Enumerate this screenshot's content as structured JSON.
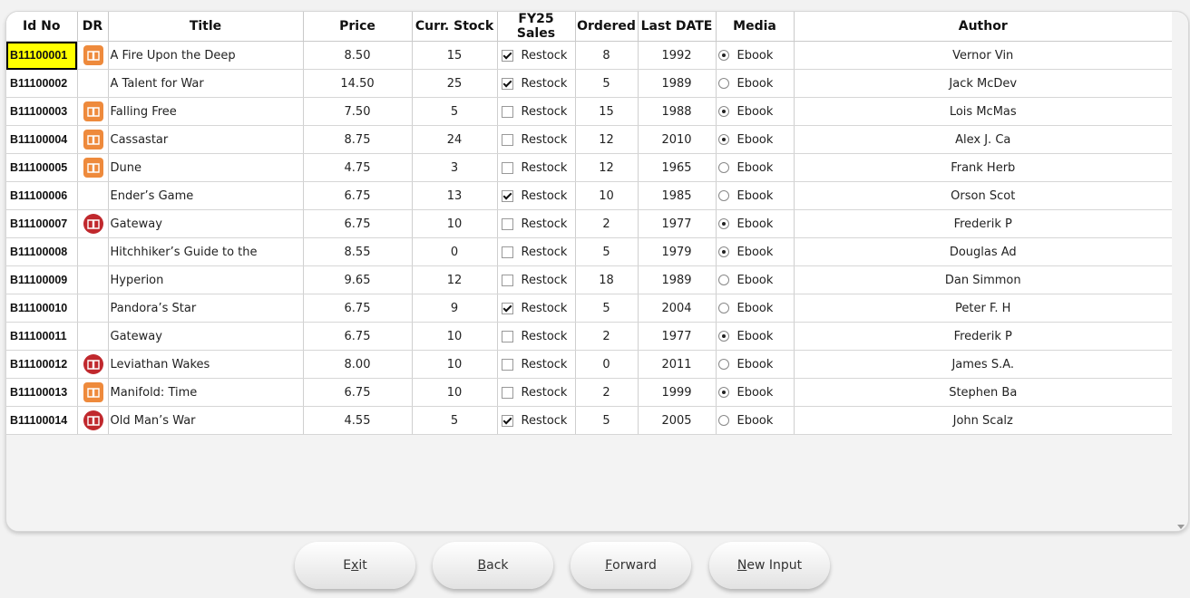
{
  "columns": [
    "Id No",
    "DR",
    "Title",
    "Price",
    "Curr. Stock",
    "FY25 Sales",
    "Ordered",
    "Last DATE",
    "Media",
    "Author"
  ],
  "rows": [
    {
      "id": "B11100001",
      "dr": "square",
      "title": "A Fire Upon the Deep",
      "price": "8.50",
      "stock": "15",
      "sales_checked": true,
      "sales_label": "Restock",
      "ordered": "8",
      "date": "1992",
      "media_on": true,
      "media": "Ebook",
      "author": "Vernor Vin"
    },
    {
      "id": "B11100002",
      "dr": "none",
      "title": "A Talent for War",
      "price": "14.50",
      "stock": "25",
      "sales_checked": true,
      "sales_label": "Restock",
      "ordered": "5",
      "date": "1989",
      "media_on": false,
      "media": "Ebook",
      "author": "Jack McDev"
    },
    {
      "id": "B11100003",
      "dr": "square",
      "title": "Falling Free",
      "price": "7.50",
      "stock": "5",
      "sales_checked": false,
      "sales_label": "Restock",
      "ordered": "15",
      "date": "1988",
      "media_on": true,
      "media": "Ebook",
      "author": "Lois McMas"
    },
    {
      "id": "B11100004",
      "dr": "square",
      "title": "Cassastar",
      "price": "8.75",
      "stock": "24",
      "sales_checked": false,
      "sales_label": "Restock",
      "ordered": "12",
      "date": "2010",
      "media_on": true,
      "media": "Ebook",
      "author": "Alex J. Ca"
    },
    {
      "id": "B11100005",
      "dr": "square",
      "title": "Dune",
      "price": "4.75",
      "stock": "3",
      "sales_checked": false,
      "sales_label": "Restock",
      "ordered": "12",
      "date": "1965",
      "media_on": false,
      "media": "Ebook",
      "author": "Frank Herb"
    },
    {
      "id": "B11100006",
      "dr": "none",
      "title": "Ender’s Game",
      "price": "6.75",
      "stock": "13",
      "sales_checked": true,
      "sales_label": "Restock",
      "ordered": "10",
      "date": "1985",
      "media_on": false,
      "media": "Ebook",
      "author": "Orson Scot"
    },
    {
      "id": "B11100007",
      "dr": "circle",
      "title": "Gateway",
      "price": "6.75",
      "stock": "10",
      "sales_checked": false,
      "sales_label": "Restock",
      "ordered": "2",
      "date": "1977",
      "media_on": true,
      "media": "Ebook",
      "author": "Frederik P"
    },
    {
      "id": "B11100008",
      "dr": "none",
      "title": "Hitchhiker’s Guide to the",
      "price": "8.55",
      "stock": "0",
      "sales_checked": false,
      "sales_label": "Restock",
      "ordered": "5",
      "date": "1979",
      "media_on": true,
      "media": "Ebook",
      "author": "Douglas Ad"
    },
    {
      "id": "B11100009",
      "dr": "none",
      "title": "Hyperion",
      "price": "9.65",
      "stock": "12",
      "sales_checked": false,
      "sales_label": "Restock",
      "ordered": "18",
      "date": "1989",
      "media_on": false,
      "media": "Ebook",
      "author": "Dan Simmon"
    },
    {
      "id": "B11100010",
      "dr": "none",
      "title": "Pandora’s Star",
      "price": "6.75",
      "stock": "9",
      "sales_checked": true,
      "sales_label": "Restock",
      "ordered": "5",
      "date": "2004",
      "media_on": false,
      "media": "Ebook",
      "author": "Peter F. H"
    },
    {
      "id": "B11100011",
      "dr": "none",
      "title": "Gateway",
      "price": "6.75",
      "stock": "10",
      "sales_checked": false,
      "sales_label": "Restock",
      "ordered": "2",
      "date": "1977",
      "media_on": true,
      "media": "Ebook",
      "author": "Frederik P"
    },
    {
      "id": "B11100012",
      "dr": "circle",
      "title": "Leviathan Wakes",
      "price": "8.00",
      "stock": "10",
      "sales_checked": false,
      "sales_label": "Restock",
      "ordered": "0",
      "date": "2011",
      "media_on": false,
      "media": "Ebook",
      "author": "James S.A."
    },
    {
      "id": "B11100013",
      "dr": "square",
      "title": "Manifold: Time",
      "price": "6.75",
      "stock": "10",
      "sales_checked": false,
      "sales_label": "Restock",
      "ordered": "2",
      "date": "1999",
      "media_on": true,
      "media": "Ebook",
      "author": "Stephen Ba"
    },
    {
      "id": "B11100014",
      "dr": "circle",
      "title": "Old Man’s War",
      "price": "4.55",
      "stock": "5",
      "sales_checked": true,
      "sales_label": "Restock",
      "ordered": "5",
      "date": "2005",
      "media_on": false,
      "media": "Ebook",
      "author": "John Scalz"
    }
  ],
  "selected_row": 0,
  "buttons": {
    "exit": {
      "pre": "E",
      "u": "x",
      "post": "it"
    },
    "back": {
      "pre": "",
      "u": "B",
      "post": "ack"
    },
    "forward": {
      "pre": "",
      "u": "F",
      "post": "orward"
    },
    "new_input": {
      "pre": "",
      "u": "N",
      "post": "ew Input"
    }
  },
  "colors": {
    "selected_bg": "#ffff00",
    "dr_square": "#ee8a3c",
    "dr_circle": "#c0282d"
  },
  "icons": {
    "dr_square": "book-icon",
    "dr_circle": "book-icon"
  }
}
